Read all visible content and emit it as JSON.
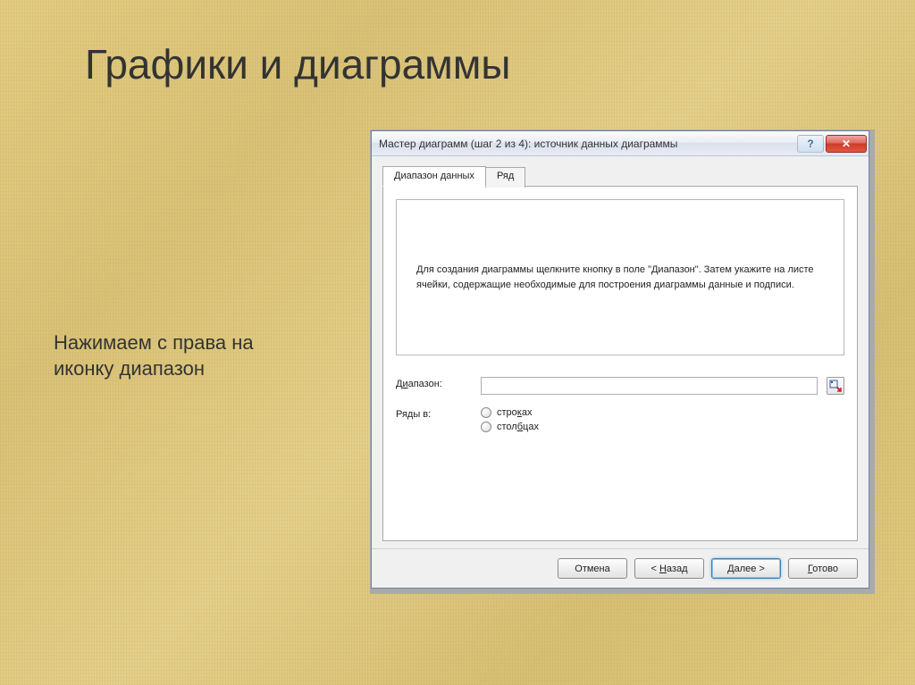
{
  "slide": {
    "title": "Графики и диаграммы",
    "caption_line1": "Нажимаем с права на",
    "caption_line2": "иконку диапазон"
  },
  "dialog": {
    "title": "Мастер диаграмм (шаг 2 из 4): источник данных диаграммы",
    "tabs": {
      "data_range": "Диапазон данных",
      "series": "Ряд"
    },
    "preview_text": "Для создания диаграммы щелкните кнопку в поле \"Диапазон\". Затем укажите на листе ячейки, содержащие необходимые для построения диаграммы данные и подписи.",
    "labels": {
      "range": "Диапазон:",
      "series_in": "Ряды в:"
    },
    "range_value": "",
    "radios": {
      "rows": "строках",
      "columns": "столбцах"
    },
    "buttons": {
      "cancel": "Отмена",
      "back_prefix": "< ",
      "back_u": "Н",
      "back_rest": "азад",
      "next_u": "Д",
      "next_rest": "алее >",
      "finish_u": "Г",
      "finish_rest": "отово"
    }
  }
}
